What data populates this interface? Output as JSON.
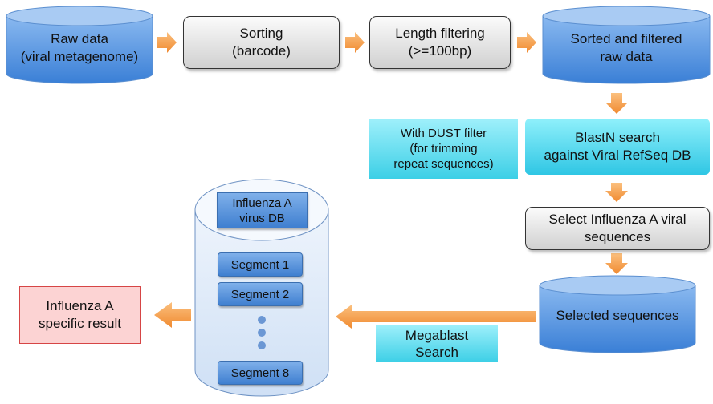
{
  "nodes": {
    "raw_data": "Raw data\n(viral metagenome)",
    "sorting": "Sorting\n(barcode)",
    "length_filtering": "Length filtering\n(>=100bp)",
    "sorted_filtered": "Sorted and filtered\nraw data",
    "dust_filter": "With DUST filter\n(for trimming\nrepeat sequences)",
    "blastn": "BlastN search\nagainst Viral RefSeq DB",
    "select_influenza": "Select Influenza A viral\nsequences",
    "selected_sequences": "Selected sequences",
    "megablast": "Megablast\nSearch",
    "influenza_db": "Influenza A\nvirus DB",
    "segment1": "Segment 1",
    "segment2": "Segment 2",
    "segment8": "Segment 8",
    "result": "Influenza A\nspecific result"
  },
  "colors": {
    "arrow": "#f5a04a",
    "database": "#4f8fdc",
    "cyan": "#5ad8ec",
    "result": "#fcd3d3"
  }
}
